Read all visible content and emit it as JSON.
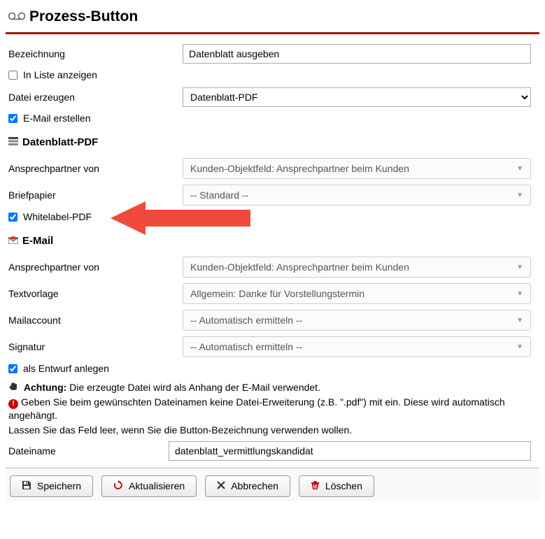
{
  "header": {
    "title": "Prozess-Button"
  },
  "form": {
    "bezeichnung_label": "Bezeichnung",
    "bezeichnung_value": "Datenblatt ausgeben",
    "in_liste_label": "In Liste anzeigen",
    "in_liste_checked": false,
    "datei_erzeugen_label": "Datei erzeugen",
    "datei_erzeugen_value": "Datenblatt-PDF",
    "email_erstellen_label": "E-Mail erstellen",
    "email_erstellen_checked": true
  },
  "pdf_section": {
    "title": "Datenblatt-PDF",
    "ansprech_label": "Ansprechpartner von",
    "ansprech_value": "Kunden-Objektfeld: Ansprechpartner beim Kunden",
    "briefpapier_label": "Briefpapier",
    "briefpapier_value": "-- Standard --",
    "whitelabel_label": "Whitelabel-PDF",
    "whitelabel_checked": true
  },
  "email_section": {
    "title": "E-Mail",
    "ansprech_label": "Ansprechpartner von",
    "ansprech_value": "Kunden-Objektfeld: Ansprechpartner beim Kunden",
    "textvorlage_label": "Textvorlage",
    "textvorlage_value": "Allgemein: Danke für Vorstellungstermin",
    "mailaccount_label": "Mailaccount",
    "mailaccount_value": "-- Automatisch ermitteln --",
    "signatur_label": "Signatur",
    "signatur_value": "-- Automatisch ermitteln --",
    "als_entwurf_label": "als Entwurf anlegen",
    "als_entwurf_checked": true,
    "achtung_label": "Achtung:",
    "achtung_text": " Die erzeugte Datei wird als Anhang der E-Mail verwendet.",
    "warn_text": "Geben Sie beim gewünschten Dateinamen keine Datei-Erweiterung (z.B. \".pdf\") mit ein. Diese wird automatisch angehängt.",
    "warn_text2": "Lassen Sie das Feld leer, wenn Sie die Button-Bezeichnung verwenden wollen.",
    "dateiname_label": "Dateiname",
    "dateiname_value": "datenblatt_vermittlungskandidat"
  },
  "buttons": {
    "save": "Speichern",
    "refresh": "Aktualisieren",
    "cancel": "Abbrechen",
    "delete": "Löschen"
  }
}
